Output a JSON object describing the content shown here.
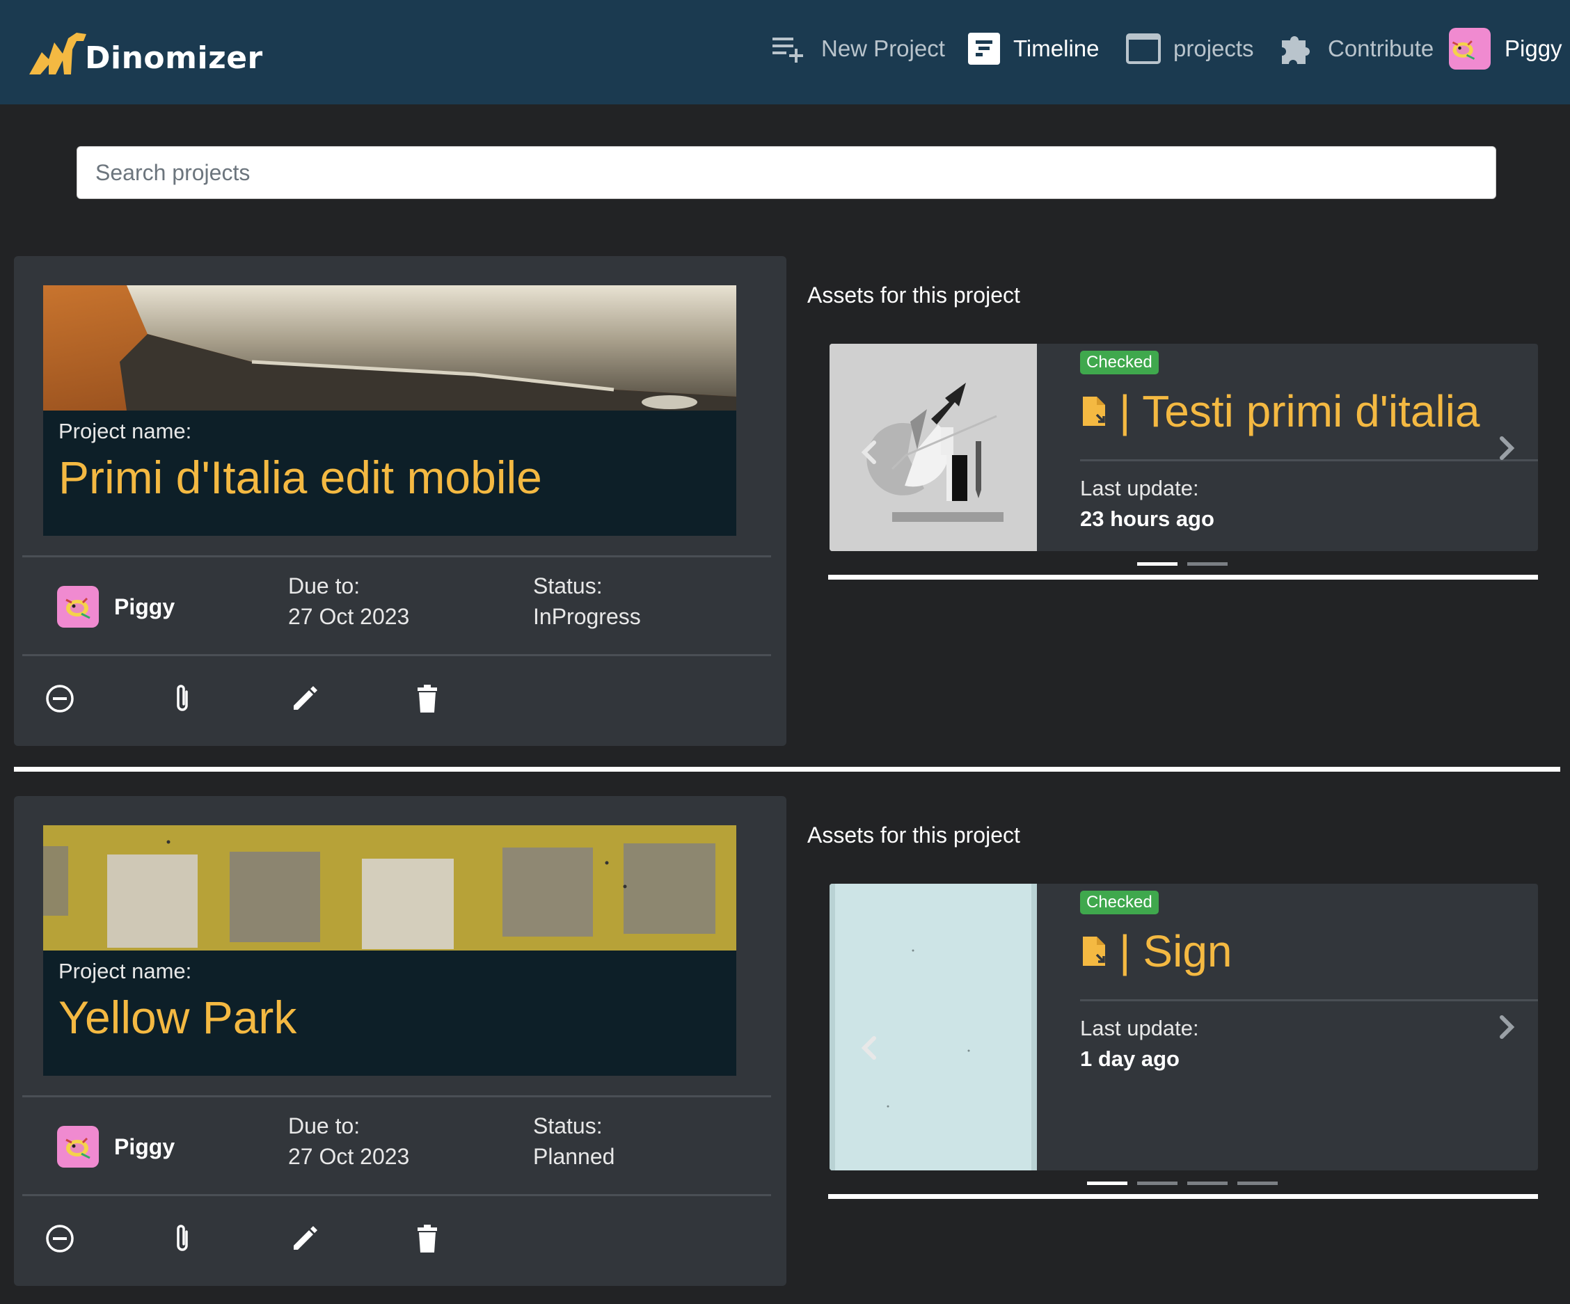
{
  "app": {
    "brand": "Dinomizer",
    "accent": "#f4b942",
    "header_bg": "#1b3a50"
  },
  "nav": {
    "new_project": "New Project",
    "timeline": "Timeline",
    "projects": "projects",
    "contribute": "Contribute",
    "user": "Piggy"
  },
  "search": {
    "placeholder": "Search projects",
    "value": ""
  },
  "projects": [
    {
      "name_label": "Project name:",
      "name": "Primi d'Italia edit mobile",
      "owner": "Piggy",
      "due_label": "Due to:",
      "due": "27 Oct 2023",
      "status_label": "Status:",
      "status": "InProgress",
      "assets_title": "Assets for this project",
      "asset": {
        "badge": "Checked",
        "title": "| Testi primi d'italia",
        "update_label": "Last update:",
        "update_value": "23 hours ago",
        "slides": 2,
        "active_slide": 1
      }
    },
    {
      "name_label": "Project name:",
      "name": "Yellow Park",
      "owner": "Piggy",
      "due_label": "Due to:",
      "due": "27 Oct 2023",
      "status_label": "Status:",
      "status": "Planned",
      "assets_title": "Assets for this project",
      "asset": {
        "badge": "Checked",
        "title": "| Sign",
        "update_label": "Last update:",
        "update_value": "1 day ago",
        "slides": 4,
        "active_slide": 1
      }
    }
  ]
}
